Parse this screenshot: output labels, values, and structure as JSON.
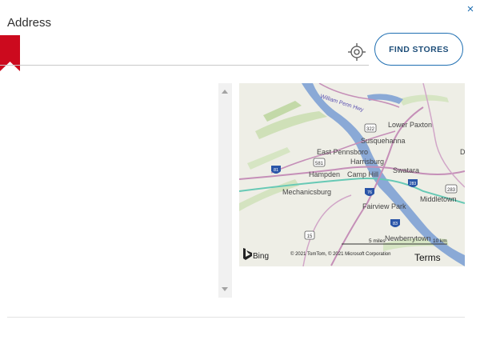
{
  "window": {
    "close_label": "×"
  },
  "address": {
    "label": "Address",
    "value": "",
    "placeholder": ""
  },
  "actions": {
    "find_stores": "FIND STORES"
  },
  "icons": {
    "close": "close-icon",
    "locate": "crosshair-locate-icon",
    "ribbon": "bookmark-ribbon-icon",
    "bing": "bing-logo-icon"
  },
  "colors": {
    "accent": "#1f6fb2",
    "ribbon": "#cc0a1e",
    "river": "#8aa9d6"
  },
  "map": {
    "places": {
      "lower_paxton": "Lower Paxton",
      "susquehanna": "Susquehanna",
      "east_pennsboro": "East Pennsboro",
      "harrisburg": "Harrisburg",
      "hampden": "Hampden",
      "camp_hill": "Camp Hill",
      "swatara": "Swatara",
      "mechanicsburg": "Mechanicsburg",
      "middletown": "Middletown",
      "fairview_park": "Fairview Park",
      "newberrytown": "Newberrytown",
      "d": "D",
      "william_penn": "William Penn Hwy"
    },
    "shields": {
      "s322": "322",
      "s581": "581",
      "s81": "81",
      "s76": "76",
      "s283": "283",
      "s283b": "283",
      "s83": "83",
      "s15": "15"
    },
    "scale_miles": "5 miles",
    "scale_km": "10 km",
    "bing": "Bing",
    "copyright": "© 2021 TomTom, © 2021 Microsoft Corporation",
    "terms": "Terms"
  }
}
